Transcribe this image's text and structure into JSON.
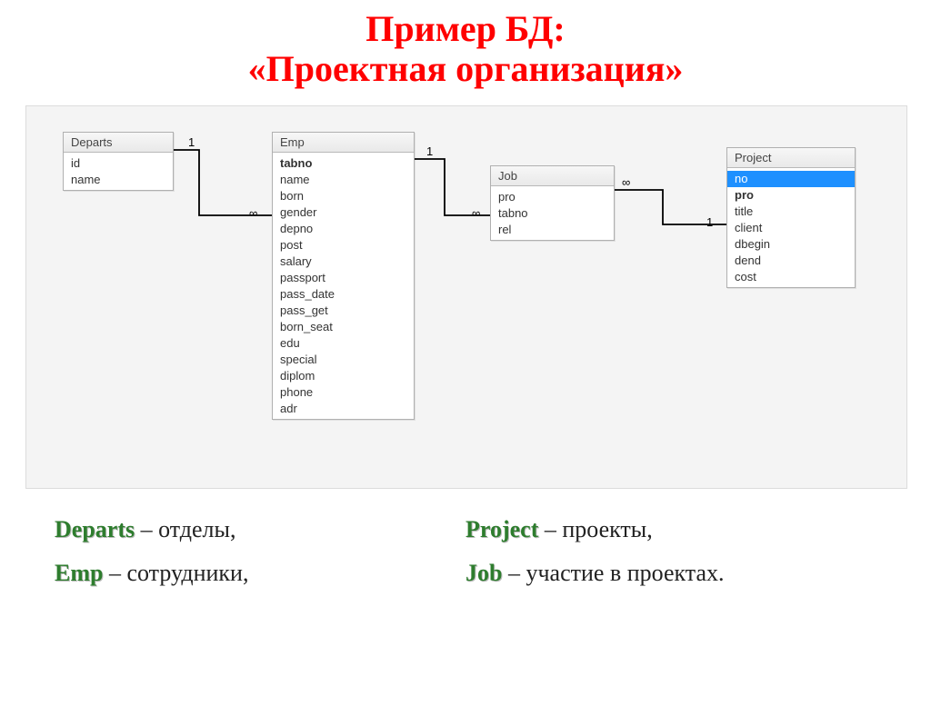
{
  "title_line1": "Пример БД:",
  "title_line2": "«Проектная организация»",
  "tables": {
    "departs": {
      "name": "Departs",
      "fields": [
        {
          "name": "id",
          "bold": false,
          "selected": false
        },
        {
          "name": "name",
          "bold": false,
          "selected": false
        }
      ]
    },
    "emp": {
      "name": "Emp",
      "fields": [
        {
          "name": "tabno",
          "bold": true,
          "selected": false
        },
        {
          "name": "name",
          "bold": false,
          "selected": false
        },
        {
          "name": "born",
          "bold": false,
          "selected": false
        },
        {
          "name": "gender",
          "bold": false,
          "selected": false
        },
        {
          "name": "depno",
          "bold": false,
          "selected": false
        },
        {
          "name": "post",
          "bold": false,
          "selected": false
        },
        {
          "name": "salary",
          "bold": false,
          "selected": false
        },
        {
          "name": "passport",
          "bold": false,
          "selected": false
        },
        {
          "name": "pass_date",
          "bold": false,
          "selected": false
        },
        {
          "name": "pass_get",
          "bold": false,
          "selected": false
        },
        {
          "name": "born_seat",
          "bold": false,
          "selected": false
        },
        {
          "name": "edu",
          "bold": false,
          "selected": false
        },
        {
          "name": "special",
          "bold": false,
          "selected": false
        },
        {
          "name": "diplom",
          "bold": false,
          "selected": false
        },
        {
          "name": "phone",
          "bold": false,
          "selected": false
        },
        {
          "name": "adr",
          "bold": false,
          "selected": false
        }
      ]
    },
    "job": {
      "name": "Job",
      "fields": [
        {
          "name": "pro",
          "bold": false,
          "selected": false
        },
        {
          "name": "tabno",
          "bold": false,
          "selected": false
        },
        {
          "name": "rel",
          "bold": false,
          "selected": false
        }
      ]
    },
    "project": {
      "name": "Project",
      "fields": [
        {
          "name": "no",
          "bold": false,
          "selected": true
        },
        {
          "name": "pro",
          "bold": true,
          "selected": false
        },
        {
          "name": "title",
          "bold": false,
          "selected": false
        },
        {
          "name": "client",
          "bold": false,
          "selected": false
        },
        {
          "name": "dbegin",
          "bold": false,
          "selected": false
        },
        {
          "name": "dend",
          "bold": false,
          "selected": false
        },
        {
          "name": "cost",
          "bold": false,
          "selected": false
        }
      ]
    }
  },
  "relations": {
    "one": "1",
    "many": "∞"
  },
  "legend": {
    "departs_term": "Departs",
    "departs_desc": " – отделы,",
    "project_term": "Project",
    "project_desc": " – проекты,",
    "emp_term": "Emp",
    "emp_desc": " – сотрудники,",
    "job_term": "Job",
    "job_desc": "  – участие в проектах."
  }
}
